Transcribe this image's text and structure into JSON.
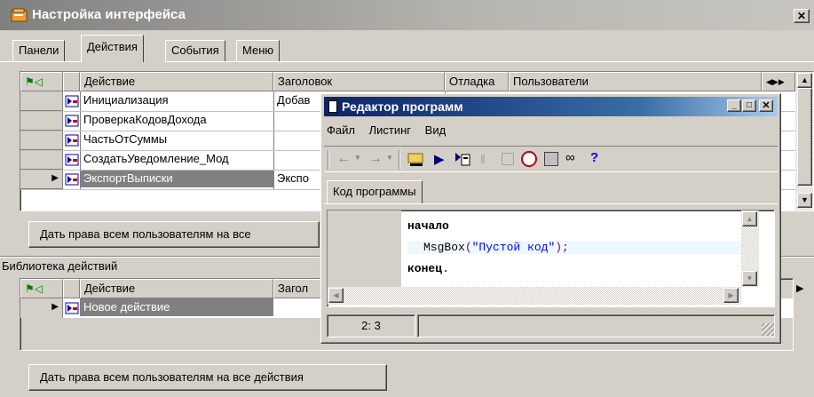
{
  "window": {
    "title": "Настройка интерфейса",
    "close": "✕"
  },
  "tabs": [
    {
      "label": "Панели"
    },
    {
      "label": "Действия"
    },
    {
      "label": "События"
    },
    {
      "label": "Меню"
    }
  ],
  "actions_table": {
    "columns": [
      "Действие",
      "Заголовок",
      "Отладка",
      "Пользователи"
    ],
    "rows": [
      {
        "action": "Инициализация",
        "caption": "Добав"
      },
      {
        "action": "ПроверкаКодовДохода",
        "caption": ""
      },
      {
        "action": "ЧастьОтСуммы",
        "caption": ""
      },
      {
        "action": "СоздатьУведомление_Мод",
        "caption": ""
      },
      {
        "action": "ЭкспортВыписки",
        "caption": "Экспо"
      }
    ]
  },
  "grant_button_top": "Дать права всем пользователям на все",
  "library": {
    "label": "Библиотека действий",
    "columns": [
      "Действие",
      "Загол"
    ],
    "rows": [
      {
        "action": "Новое действие"
      }
    ]
  },
  "grant_button_bottom": "Дать права всем пользователям на все действия",
  "editor": {
    "title": "Редактор программ",
    "menu": [
      "Файл",
      "Листинг",
      "Вид"
    ],
    "tab": "Код программы",
    "code": {
      "line1": "начало",
      "line2_func": "MsgBox",
      "line2_open": "(",
      "line2_str": "\"Пустой код\"",
      "line2_close": ");",
      "line3": "конец",
      "line3_dot": "."
    },
    "status": {
      "position": "2: 3"
    },
    "help_icon": "?"
  },
  "colors": {
    "title_active": "#0a246a",
    "selection": "#808080",
    "code_string": "#0000ff",
    "code_punct": "#800080"
  }
}
